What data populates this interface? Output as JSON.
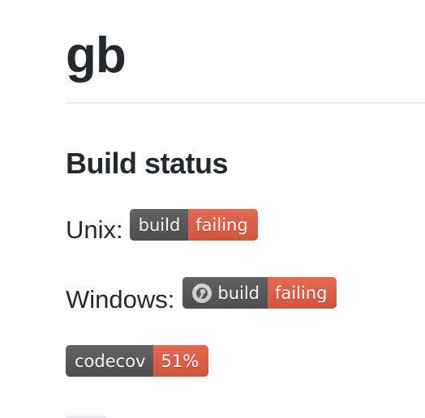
{
  "page": {
    "title": "gb"
  },
  "build_status": {
    "heading": "Build status",
    "unix": {
      "label": "Unix:",
      "badge_left": "build",
      "badge_right": "failing"
    },
    "windows": {
      "label": "Windows:",
      "icon": "appveyor-icon",
      "badge_left": "build",
      "badge_right": "failing"
    },
    "codecov": {
      "badge_left": "codecov",
      "badge_right": "51%"
    }
  },
  "colors": {
    "badge_left_bg": "#555555",
    "badge_failing_bg": "#e05d44",
    "text": "#24292e",
    "rule": "#eaecef"
  }
}
